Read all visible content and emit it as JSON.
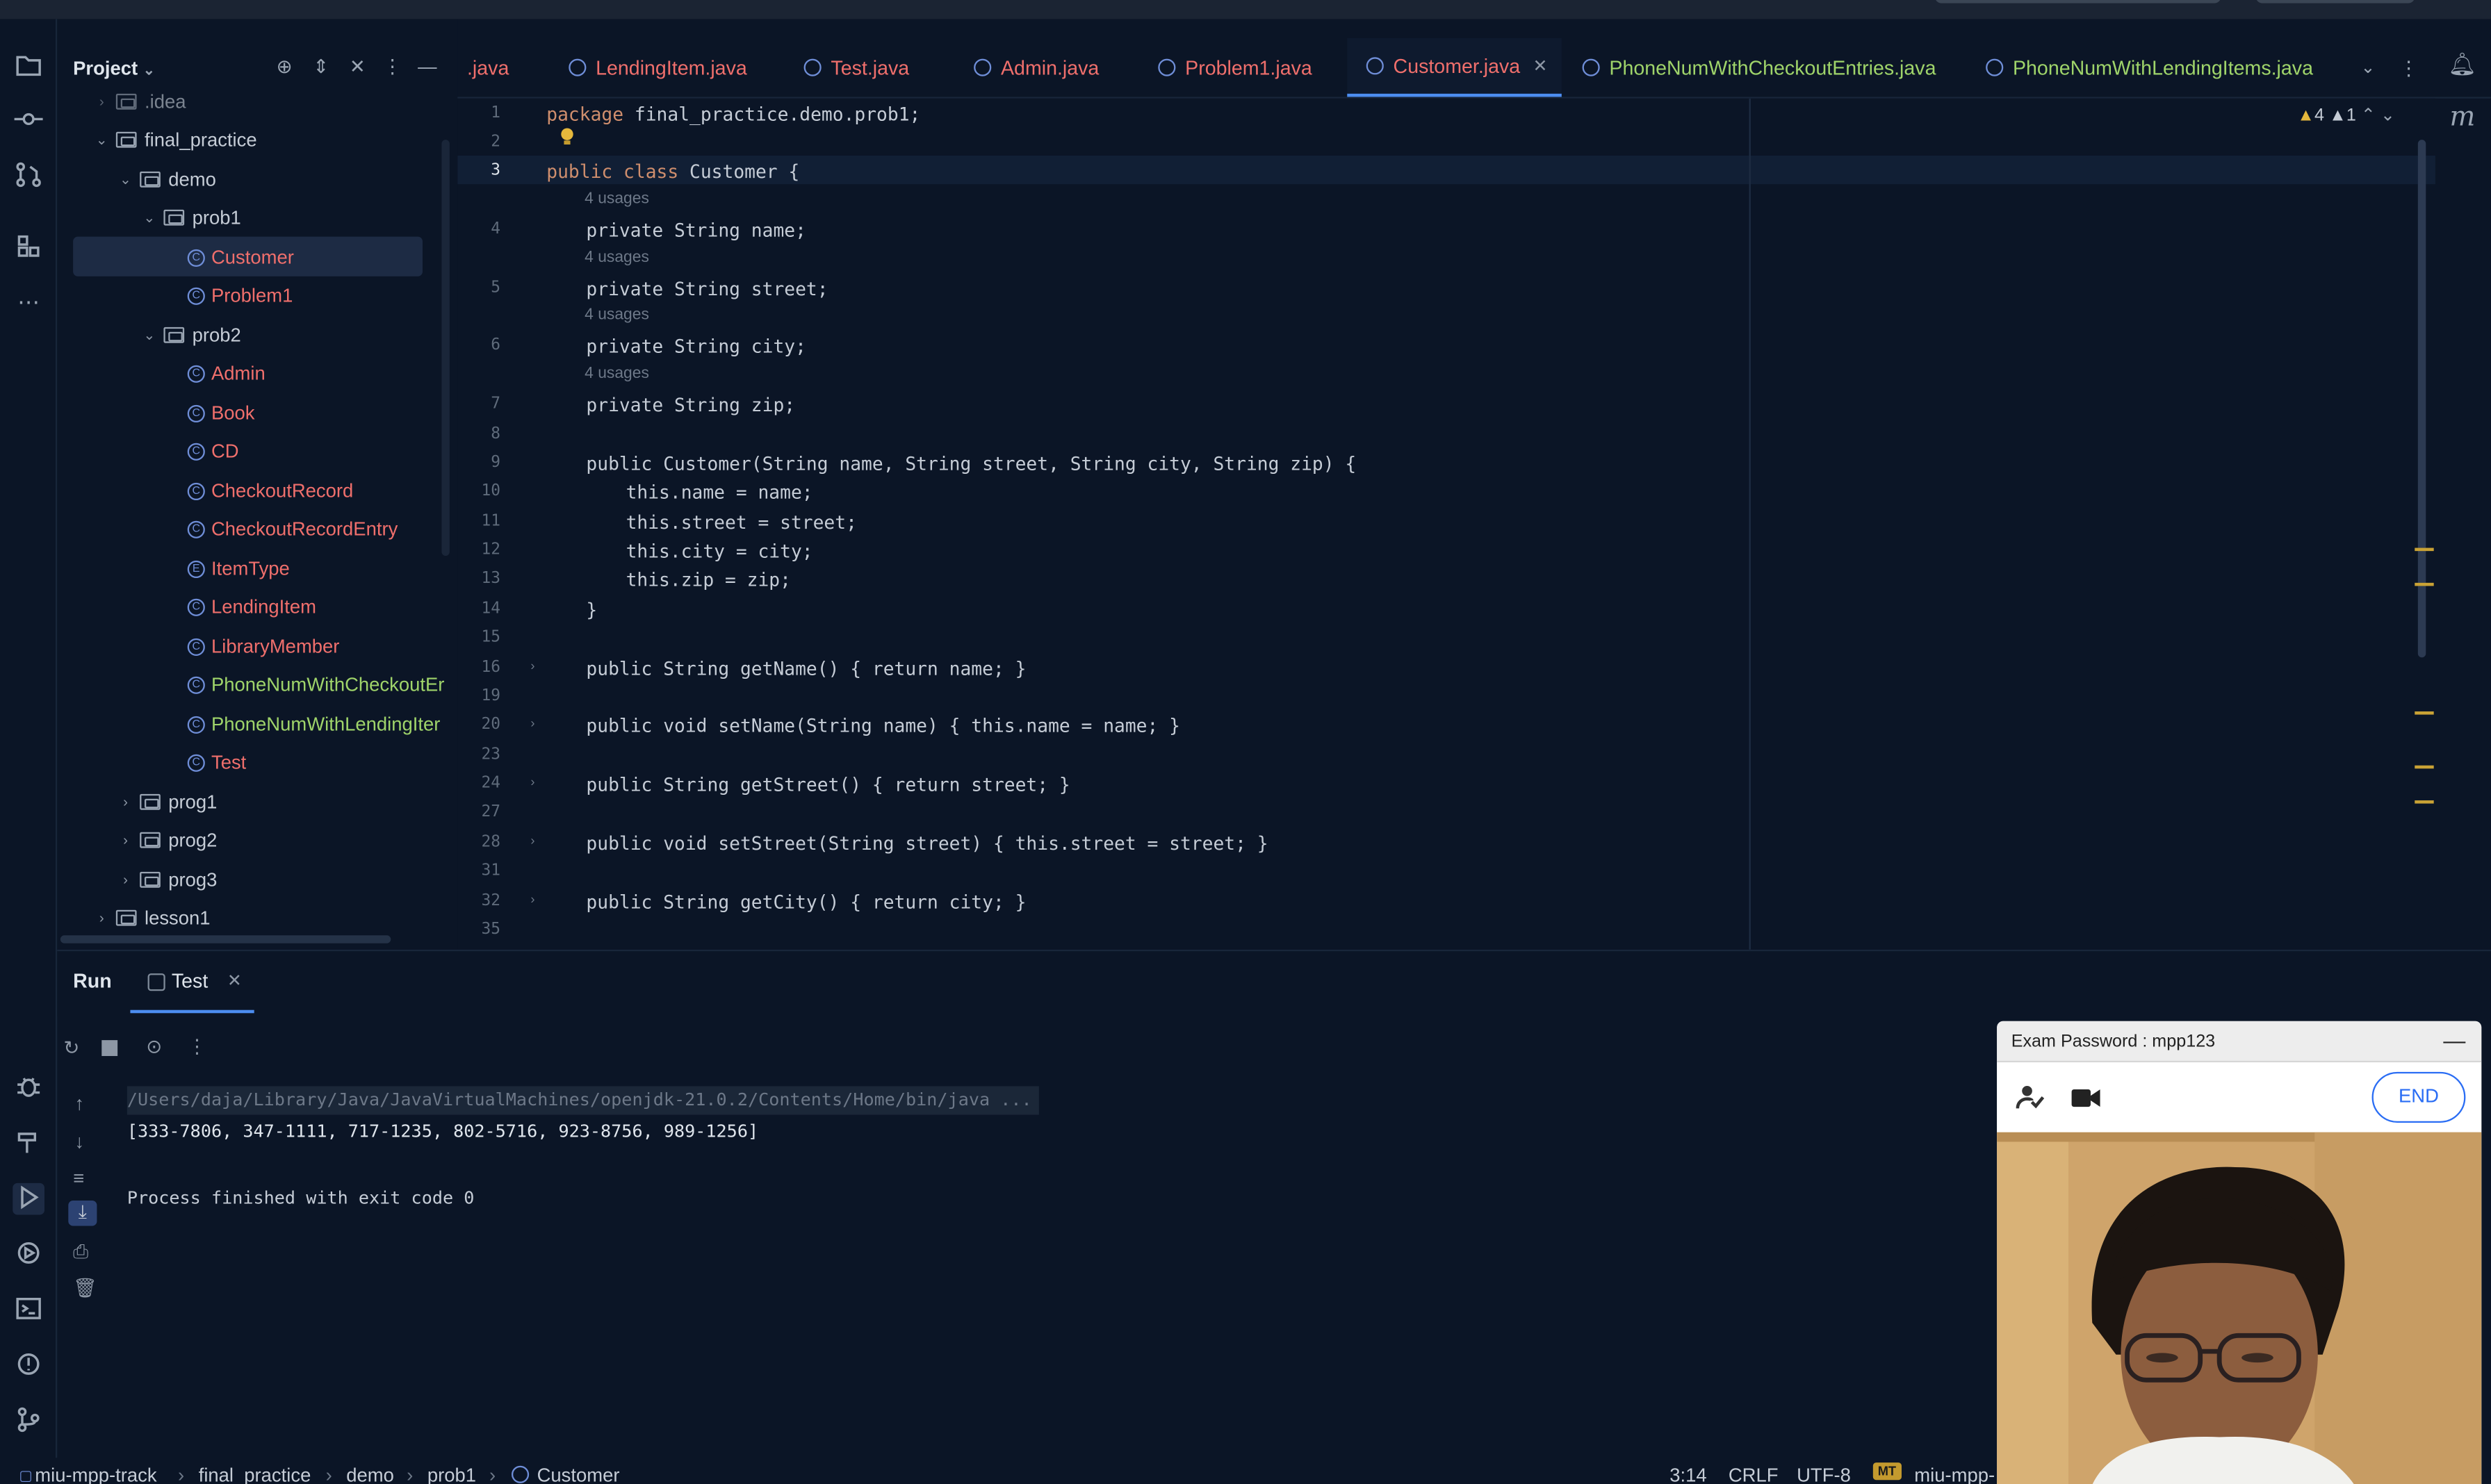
{
  "project_panel": {
    "title": "Project",
    "tree": [
      {
        "label": ".idea",
        "kind": "folder"
      },
      {
        "label": "final_practice",
        "kind": "folder"
      },
      {
        "label": "demo",
        "kind": "folder"
      },
      {
        "label": "prob1",
        "kind": "folder"
      },
      {
        "label": "Customer",
        "kind": "class"
      },
      {
        "label": "Problem1",
        "kind": "class"
      },
      {
        "label": "prob2",
        "kind": "folder"
      },
      {
        "label": "Admin",
        "kind": "class"
      },
      {
        "label": "Book",
        "kind": "class"
      },
      {
        "label": "CD",
        "kind": "class"
      },
      {
        "label": "CheckoutRecord",
        "kind": "class"
      },
      {
        "label": "CheckoutRecordEntry",
        "kind": "class"
      },
      {
        "label": "ItemType",
        "kind": "enum"
      },
      {
        "label": "LendingItem",
        "kind": "class"
      },
      {
        "label": "LibraryMember",
        "kind": "class"
      },
      {
        "label": "PhoneNumWithCheckoutEr",
        "kind": "class"
      },
      {
        "label": "PhoneNumWithLendingIter",
        "kind": "class"
      },
      {
        "label": "Test",
        "kind": "class"
      },
      {
        "label": "prog1",
        "kind": "folder"
      },
      {
        "label": "prog2",
        "kind": "folder"
      },
      {
        "label": "prog3",
        "kind": "folder"
      },
      {
        "label": "lesson1",
        "kind": "folder"
      }
    ]
  },
  "tabs": [
    {
      "label": ".java"
    },
    {
      "label": "LendingItem.java"
    },
    {
      "label": "Test.java"
    },
    {
      "label": "Admin.java"
    },
    {
      "label": "Problem1.java"
    },
    {
      "label": "Customer.java",
      "active": true
    },
    {
      "label": "PhoneNumWithCheckoutEntries.java"
    },
    {
      "label": "PhoneNumWithLendingItems.java"
    }
  ],
  "editor": {
    "inspections": {
      "warnings": "4",
      "weak_warnings": "1"
    },
    "usages_label": "4 usages",
    "line_numbers": [
      "1",
      "2",
      "3",
      "4",
      "5",
      "6",
      "7",
      "8",
      "9",
      "10",
      "11",
      "12",
      "13",
      "14",
      "15",
      "16",
      "19",
      "20",
      "23",
      "24",
      "27",
      "28",
      "31",
      "32",
      "35"
    ],
    "code": {
      "l1_kw": "package",
      "l1_rest": " final_practice.demo.prob1;",
      "l3_kw": "public class",
      "l3_rest": " Customer {",
      "l4": "private String name;",
      "l5": "private String street;",
      "l6": "private String city;",
      "l7": "private String zip;",
      "l9": "public Customer(String name, String street, String city, String zip) {",
      "l10": "this.name = name;",
      "l11": "this.street = street;",
      "l12": "this.city = city;",
      "l13": "this.zip = zip;",
      "l14": "}",
      "l16": "public String getName() { return name; }",
      "l20": "public void setName(String name) { this.name = name; }",
      "l24": "public String getStreet() { return street; }",
      "l28": "public void setStreet(String street) { this.street = street; }",
      "l32": "public String getCity() { return city; }"
    }
  },
  "run_panel": {
    "run_label": "Run",
    "tab_label": "Test",
    "command": "/Users/daja/Library/Java/JavaVirtualMachines/openjdk-21.0.2/Contents/Home/bin/java ...",
    "output": "[333-7806, 347-1111, 717-1235, 802-5716, 923-8756, 989-1256]",
    "exit": "Process finished with exit code 0"
  },
  "status_bar": {
    "breadcrumbs": [
      "miu-mpp-track",
      "final_practice",
      "demo",
      "prob1",
      "Customer"
    ],
    "position": "3:14",
    "line_sep": "CRLF",
    "encoding": "UTF-8",
    "badge": "MT",
    "project": "miu-mpp-"
  },
  "exam_widget": {
    "title": "Exam Password : mpp123",
    "end_label": "END"
  }
}
